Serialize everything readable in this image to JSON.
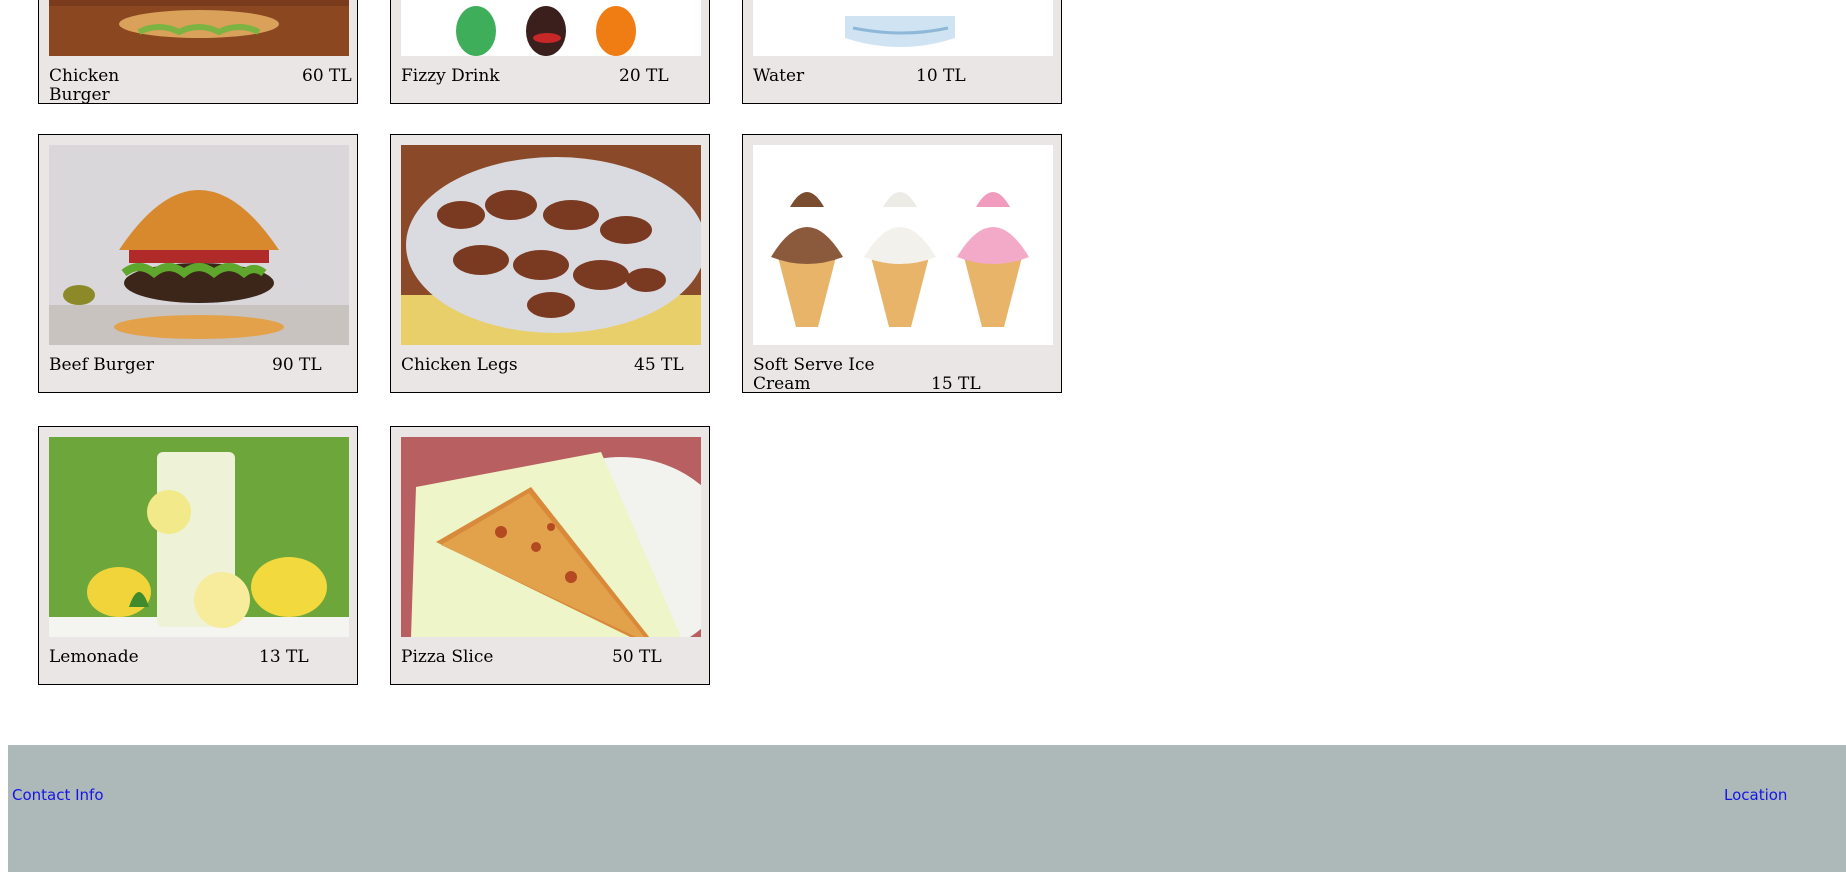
{
  "menu": {
    "items": [
      {
        "name": "Chicken Burger",
        "price": "60 TL"
      },
      {
        "name": "Fizzy Drink",
        "price": "20 TL"
      },
      {
        "name": "Water",
        "price": "10 TL"
      },
      {
        "name": "Beef Burger",
        "price": "90 TL"
      },
      {
        "name": "Chicken Legs",
        "price": "45 TL"
      },
      {
        "name": "Soft Serve Ice Cream",
        "price": "15 TL"
      },
      {
        "name": "Lemonade",
        "price": "13 TL"
      },
      {
        "name": "Pizza Slice",
        "price": "50 TL"
      }
    ]
  },
  "footer": {
    "contact_label": "Contact Info",
    "location_label": "Location"
  }
}
